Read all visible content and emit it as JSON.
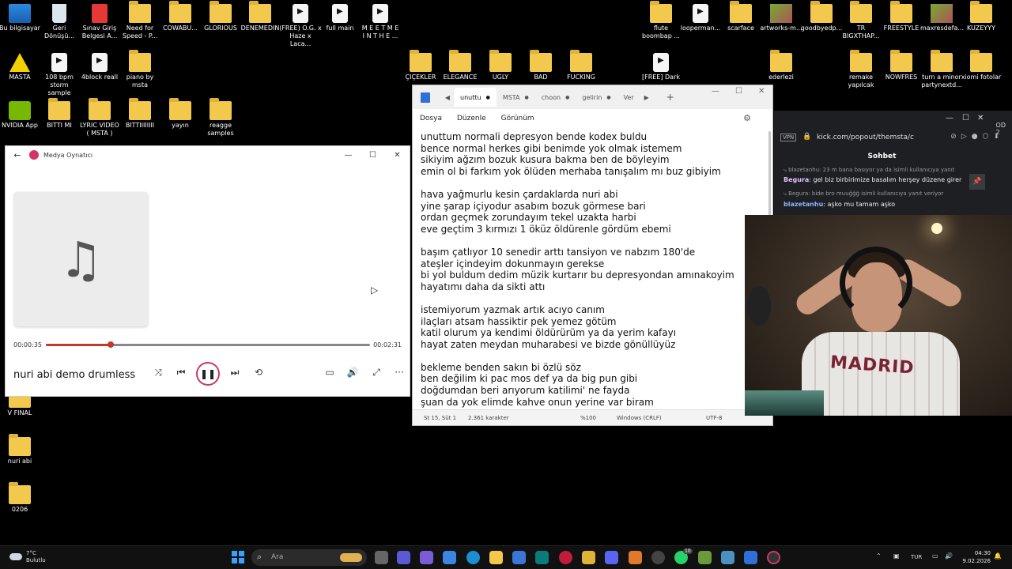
{
  "desktop_icons": [
    {
      "label": "Bu bilgisayar",
      "icon": "pc-icon"
    },
    {
      "label": "Geri\nDönüşü...",
      "icon": "recycle-bin-icon"
    },
    {
      "label": "Sınav Giriş\nBelgesi A...",
      "icon": "pdf-icon"
    },
    {
      "label": "Need for\nSpeed - P...",
      "icon": "folder-icon"
    },
    {
      "label": "COWABU...",
      "icon": "folder-icon"
    },
    {
      "label": "GLORIOUS",
      "icon": "folder-icon"
    },
    {
      "label": "DENEMEDIN",
      "icon": "folder-icon"
    },
    {
      "label": "(FREE) O.G. x\nHaze x Laca...",
      "icon": "audio-file-icon"
    },
    {
      "label": "full main",
      "icon": "audio-file-icon"
    },
    {
      "label": "M E E T  M E\nI N  T H E ...",
      "icon": "audio-file-icon"
    },
    {
      "label": "MASTA",
      "icon": "warning-icon"
    },
    {
      "label": "108 bpm\nstorm sample",
      "icon": "audio-file-icon"
    },
    {
      "label": "4block reall",
      "icon": "file-icon"
    },
    {
      "label": "piano by\nmsta",
      "icon": "folder-icon"
    },
    {
      "label": "NVIDIA App",
      "icon": "nvidia-icon"
    },
    {
      "label": "BITTI MI",
      "icon": "folder-icon"
    },
    {
      "label": "LYRIC VIDEO\n( MSTA )",
      "icon": "folder-icon"
    },
    {
      "label": "BITTIIIIIIII",
      "icon": "folder-icon"
    },
    {
      "label": "yayın",
      "icon": "folder-icon"
    },
    {
      "label": "reagge\nsamples",
      "icon": "folder-icon"
    },
    {
      "label": "ÇIÇEKLER",
      "icon": "folder-icon"
    },
    {
      "label": "ELEGANCE",
      "icon": "folder-icon"
    },
    {
      "label": "UGLY",
      "icon": "folder-icon"
    },
    {
      "label": "BAD",
      "icon": "folder-icon"
    },
    {
      "label": "FUCKING",
      "icon": "folder-icon"
    },
    {
      "label": "[FREE] Dark",
      "icon": "audio-file-icon"
    },
    {
      "label": "flute\nboombap ...",
      "icon": "folder-icon"
    },
    {
      "label": "looperman...",
      "icon": "audio-file-icon"
    },
    {
      "label": "scarface",
      "icon": "folder-icon"
    },
    {
      "label": "artworks-m...",
      "icon": "image-icon"
    },
    {
      "label": "goodbyedp...",
      "icon": "folder-icon"
    },
    {
      "label": "TR\nBIGXTHAP...",
      "icon": "folder-icon"
    },
    {
      "label": "FREESTYLE",
      "icon": "folder-icon"
    },
    {
      "label": "maxresdefa...",
      "icon": "image-icon"
    },
    {
      "label": "KUZEYYY",
      "icon": "folder-icon"
    },
    {
      "label": "ederlezi",
      "icon": "folder-icon"
    },
    {
      "label": "remake\nyapılcak",
      "icon": "folder-icon"
    },
    {
      "label": "NOWFRES",
      "icon": "folder-icon"
    },
    {
      "label": "turn a minor\npartynextd...",
      "icon": "folder-icon"
    },
    {
      "label": "xiomi fotolar",
      "icon": "folder-icon"
    },
    {
      "label": "V FINAL",
      "icon": "folder-icon"
    },
    {
      "label": "nuri abi",
      "icon": "folder-icon"
    },
    {
      "label": "0206",
      "icon": "folder-icon"
    }
  ],
  "media_player": {
    "title": "Medya Oynatıcı",
    "elapsed": "00:00:35",
    "duration": "00:02:31",
    "progress": 0.2,
    "song_title": "nuri abi demo drumless"
  },
  "notepad": {
    "tabs": [
      "unuttu",
      "MSTA",
      "choon",
      "gelirin",
      "Ver"
    ],
    "menu": [
      "Dosya",
      "Düzenle",
      "Görünüm"
    ],
    "lines": [
      [
        "unuttum normali depresyon bende kodex buldu",
        "bence normal herkes gibi benimde yok olmak istemem",
        "sikiyim ağzım bozuk kusura bakma ben de böyleyim",
        "emin ol bi farkım yok ölüden merhaba tanışalım mı buz gibiyim"
      ],
      [
        "hava yağmurlu kesin çardaklarda nuri abi",
        "yine şarap içiyodur asabım bozuk görmese bari",
        "ordan geçmek zorundayım tekel uzakta harbi",
        "eve geçtim 3 kırmızı 1 öküz öldürenle gördüm ebemi"
      ],
      [
        "başım çatlıyor 10 senedir arttı tansiyon ve nabzım 180'de",
        "ateşler içindeyim dokunmayın gerekse",
        "bi yol buldum dedim müzik kurtarır bu depresyondan amınakoyim",
        "hayatımı daha da sikti attı"
      ],
      [
        "istemiyorum yazmak artık acıyo canım",
        "ilaçları atsam hassiktir pek yemez götüm",
        "katil olurum ya kendimi öldürürüm ya da yerim kafayı",
        "hayat zaten meydan muharabesi ve bizde gönüllüyüz"
      ],
      [
        "bekleme benden sakın bi özlü söz",
        "ben değilim ki pac mos def ya da big pun gibi",
        "doğdumdan beri arıyorum katilimi' ne fayda",
        "şuan da yok elimde kahve onun yerine var biram"
      ]
    ],
    "status": {
      "position": "St 15, Süt 1",
      "chars": "2.361 karakter",
      "zoom": "%100",
      "eol": "Windows (CRLF)",
      "encoding": "UTF-8"
    }
  },
  "browser": {
    "vpn": "VPN",
    "url": "kick.com/popout/themsta/c",
    "chat_title": "Sohbet",
    "messages": [
      {
        "type": "reply",
        "text": "blazetanhu: 23 m bana basıyor ya da isimli kullanıcıya yanıt"
      },
      {
        "type": "msg",
        "user": "Begura",
        "text": ": gel biz birbirimize basalım herşey düzene girer"
      },
      {
        "type": "reply",
        "text": "Begura: bide bro muuğğğ isimli kullanıcıya yanıt veriyor"
      },
      {
        "type": "msg",
        "user": "blazetanhu",
        "text": ": aşko mu tamam aşko"
      }
    ],
    "side_text": "OD\n2"
  },
  "webcam": {
    "shirt_text": "MADRID"
  },
  "taskbar": {
    "weather_temp": "7°C",
    "weather_desc": "Bulutlu",
    "search_placeholder": "Ara",
    "lang": "TUR",
    "time": "04:30",
    "date": "9.02.2026",
    "badge": "10"
  }
}
